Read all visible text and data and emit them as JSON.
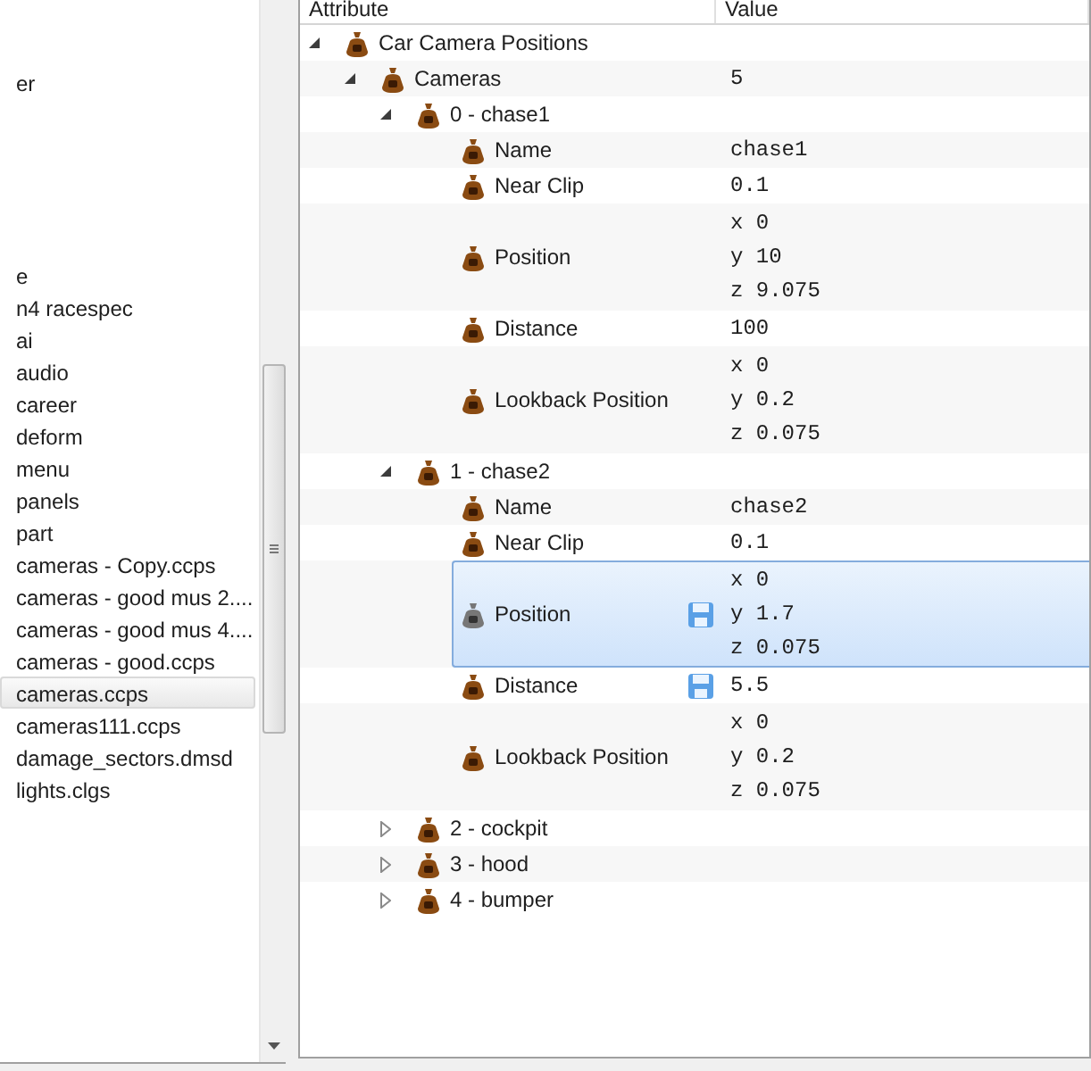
{
  "file_list": {
    "items": [
      {
        "label": "er",
        "selected": false
      },
      {
        "label": "e",
        "selected": false
      },
      {
        "label": "n4 racespec",
        "selected": false
      },
      {
        "label": "ai",
        "selected": false
      },
      {
        "label": "audio",
        "selected": false
      },
      {
        "label": "career",
        "selected": false
      },
      {
        "label": "deform",
        "selected": false
      },
      {
        "label": "menu",
        "selected": false
      },
      {
        "label": "panels",
        "selected": false
      },
      {
        "label": "part",
        "selected": false
      },
      {
        "label": "cameras - Copy.ccps",
        "selected": false
      },
      {
        "label": "cameras - good mus 2....",
        "selected": false
      },
      {
        "label": "cameras - good mus 4....",
        "selected": false
      },
      {
        "label": "cameras - good.ccps",
        "selected": false
      },
      {
        "label": "cameras.ccps",
        "selected": true
      },
      {
        "label": "cameras111.ccps",
        "selected": false
      },
      {
        "label": "damage_sectors.dmsd",
        "selected": false
      },
      {
        "label": "lights.clgs",
        "selected": false
      }
    ]
  },
  "tree": {
    "columns": [
      "Attribute",
      "Value"
    ],
    "nodes": [
      {
        "label": "Car Camera Positions",
        "expanded": true,
        "selected": false,
        "children": [
          {
            "label": "Cameras",
            "value": "5",
            "expanded": true,
            "selected": false,
            "children": [
              {
                "label": "0 - chase1",
                "expanded": true,
                "selected": false,
                "children": [
                  {
                    "label": "Name",
                    "value": "chase1",
                    "selected": false,
                    "modified": false
                  },
                  {
                    "label": "Near Clip",
                    "value": "0.1",
                    "selected": false,
                    "modified": false
                  },
                  {
                    "label": "Position",
                    "value_lines": [
                      "x 0",
                      "y 10",
                      "z 9.075"
                    ],
                    "selected": false,
                    "modified": false
                  },
                  {
                    "label": "Distance",
                    "value": "100",
                    "selected": false,
                    "modified": false
                  },
                  {
                    "label": "Lookback Position",
                    "value_lines": [
                      "x 0",
                      "y 0.2",
                      "z 0.075"
                    ],
                    "selected": false,
                    "modified": false
                  }
                ]
              },
              {
                "label": "1 - chase2",
                "expanded": true,
                "selected": false,
                "children": [
                  {
                    "label": "Name",
                    "value": "chase2",
                    "selected": false,
                    "modified": false
                  },
                  {
                    "label": "Near Clip",
                    "value": "0.1",
                    "selected": false,
                    "modified": false
                  },
                  {
                    "label": "Position",
                    "value_lines": [
                      "x 0",
                      "y 1.7",
                      "z 0.075"
                    ],
                    "selected": true,
                    "modified": true
                  },
                  {
                    "label": "Distance",
                    "value": "5.5",
                    "selected": false,
                    "modified": true
                  },
                  {
                    "label": "Lookback Position",
                    "value_lines": [
                      "x 0",
                      "y 0.2",
                      "z 0.075"
                    ],
                    "selected": false,
                    "modified": false
                  }
                ]
              },
              {
                "label": "2 - cockpit",
                "expanded": false,
                "selected": false
              },
              {
                "label": "3 - hood",
                "expanded": false,
                "selected": false
              },
              {
                "label": "4 - bumper",
                "expanded": false,
                "selected": false
              }
            ]
          }
        ]
      }
    ]
  }
}
